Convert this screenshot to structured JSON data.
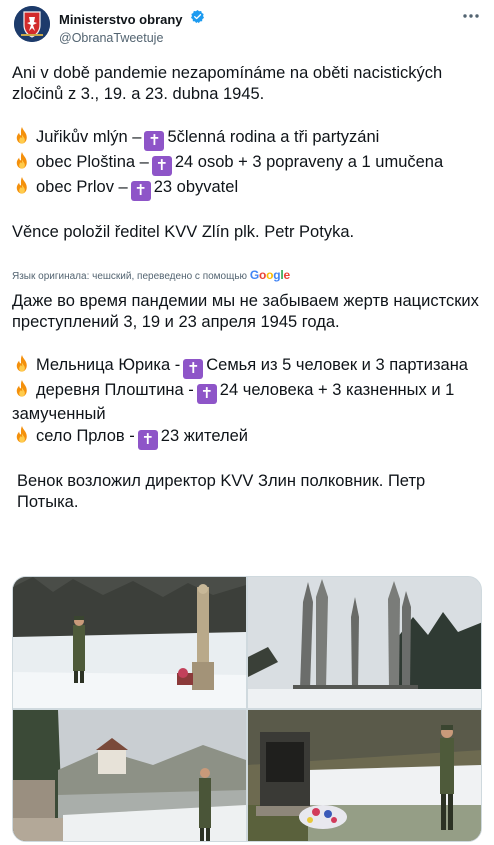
{
  "author": {
    "display_name": "Ministerstvo obrany",
    "handle": "@ObranaTweetuje",
    "verified_icon": "verified-badge-icon",
    "avatar_icon": "ministry-coat-of-arms-icon"
  },
  "tweet": {
    "intro": "Ani v době pandemie nezapomínáme na oběti nacistických zločinů z 3., 19. a 23. dubna 1945.",
    "line1_a": "Juřikův mlýn –",
    "line1_b": "5členná rodina a tři partyzáni",
    "line2_a": "obec Ploština –",
    "line2_b": "24 osob + 3 popraveny a 1 umučena",
    "line3_a": "obec Prlov –",
    "line3_b": "23 obyvatel",
    "outro": "Věnce položil ředitel KVV Zlín plk. Petr Potyka."
  },
  "translation_note": {
    "text": "Язык оригинала: чешский, переведено с помощью",
    "provider": "Google"
  },
  "translation": {
    "intro": "Даже во время пандемии мы не забываем жертв нацистских преступлений 3, 19 и 23 апреля 1945 года.",
    "line1_a": "Мельница Юрика -",
    "line1_b": "Семья из 5 человек и 3 партизана",
    "line2_a": "деревня Плоштина -",
    "line2_b": "24 человека + 3 казненных и 1 замученный",
    "line3_a": "село Прлов -",
    "line3_b": "23 жителей",
    "outro": "Венок возложил директор KVV Злин полковник. Петр Потыка."
  },
  "glyphs": {
    "cross": "✝",
    "fire_icon": "fire-emoji-icon",
    "cross_icon": "latin-cross-emoji-icon"
  },
  "colors": {
    "text": "#0f1419",
    "secondary": "#536471",
    "verified": "#1d9bf0",
    "cross_bg": "#8e55c8"
  }
}
